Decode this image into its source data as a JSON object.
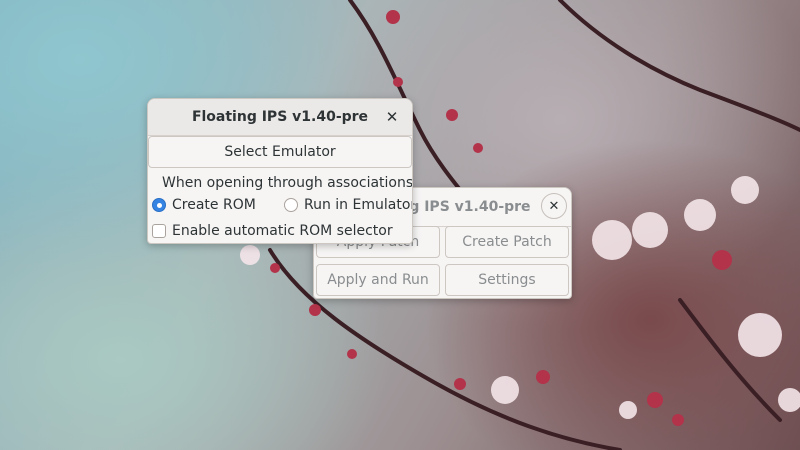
{
  "back_window": {
    "title": "Floating IPS v1.40-pre",
    "close_glyph": "✕",
    "buttons": {
      "apply_patch": "Apply Patch",
      "create_patch": "Create Patch",
      "apply_and_run": "Apply and Run",
      "settings": "Settings"
    }
  },
  "front_window": {
    "title": "Floating IPS v1.40-pre",
    "close_glyph": "✕",
    "select_emulator": "Select Emulator",
    "assoc_label": "When opening through associations:",
    "options": {
      "create_rom": "Create ROM",
      "run_in_emulator": "Run in Emulator",
      "selected": "create_rom"
    },
    "auto_rom_selector": {
      "label": "Enable automatic ROM selector",
      "checked": false
    }
  },
  "colors": {
    "accent": "#3584e4",
    "dialog_bg": "#f6f5f4",
    "text": "#2e3436"
  }
}
